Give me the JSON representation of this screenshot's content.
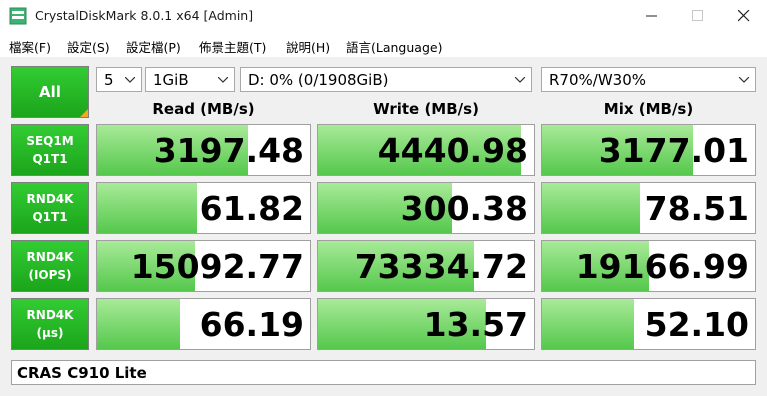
{
  "window": {
    "title": "CrystalDiskMark 8.0.1 x64 [Admin]",
    "icon": "crystaldiskmark-app-icon"
  },
  "menu": [
    "檔案(F)",
    "設定(S)",
    "設定檔(P)",
    "佈景主題(T)",
    "說明(H)",
    "語言(Language)"
  ],
  "controls": {
    "all_label": "All",
    "count": "5",
    "size": "1GiB",
    "drive": "D: 0% (0/1908GiB)",
    "mix": "R70%/W30%"
  },
  "columns": [
    "Read (MB/s)",
    "Write (MB/s)",
    "Mix (MB/s)"
  ],
  "rows": [
    {
      "label1": "SEQ1M",
      "label2": "Q1T1",
      "values": [
        "3197.48",
        "4440.98",
        "3177.01"
      ],
      "fill": [
        0.71,
        0.94,
        0.71
      ]
    },
    {
      "label1": "RND4K",
      "label2": "Q1T1",
      "values": [
        "61.82",
        "300.38",
        "78.51"
      ],
      "fill": [
        0.47,
        0.62,
        0.46
      ]
    },
    {
      "label1": "RND4K",
      "label2": "(IOPS)",
      "values": [
        "15092.77",
        "73334.72",
        "19166.99"
      ],
      "fill": [
        0.46,
        0.72,
        0.5
      ]
    },
    {
      "label1": "RND4K",
      "label2": "(µs)",
      "values": [
        "66.19",
        "13.57",
        "52.10"
      ],
      "fill": [
        0.39,
        0.78,
        0.43
      ]
    }
  ],
  "comment": "CRAS C910 Lite",
  "colors": {
    "accent_green": "#1ba51b",
    "bar_green": "#55c84c",
    "corner_orange": "#f5a623"
  }
}
